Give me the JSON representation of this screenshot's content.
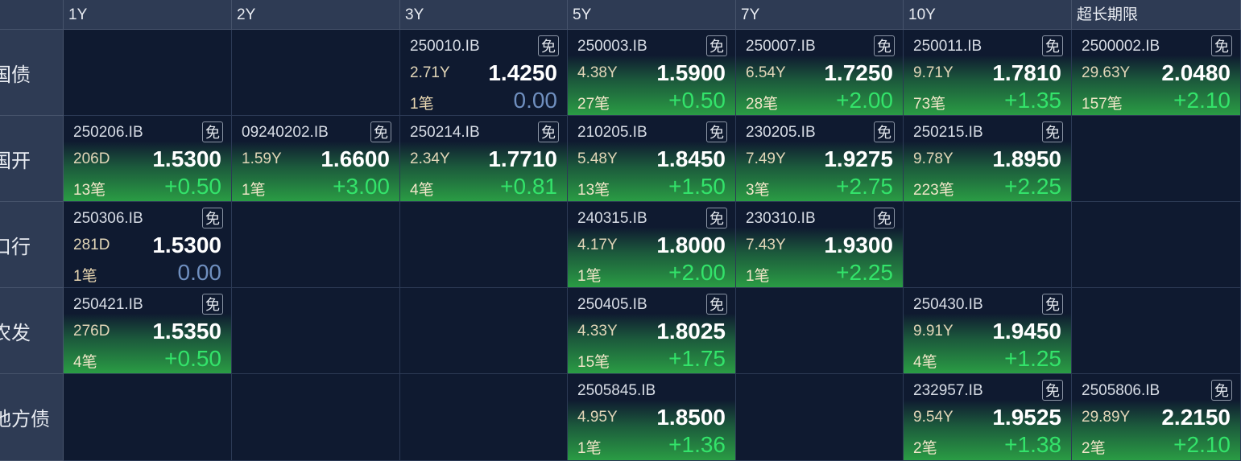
{
  "columns": [
    "1Y",
    "2Y",
    "3Y",
    "5Y",
    "7Y",
    "10Y",
    "超长期限"
  ],
  "rows": [
    {
      "label": "国债",
      "cells": [
        null,
        null,
        {
          "code": "250010.IB",
          "tax": "免",
          "term": "2.71Y",
          "yield": "1.4250",
          "count": "1笔",
          "change": "0.00",
          "style": "neutral"
        },
        {
          "code": "250003.IB",
          "tax": "免",
          "term": "4.38Y",
          "yield": "1.5900",
          "count": "27笔",
          "change": "+0.50",
          "style": "green"
        },
        {
          "code": "250007.IB",
          "tax": "免",
          "term": "6.54Y",
          "yield": "1.7250",
          "count": "28笔",
          "change": "+2.00",
          "style": "green"
        },
        {
          "code": "250011.IB",
          "tax": "免",
          "term": "9.71Y",
          "yield": "1.7810",
          "count": "73笔",
          "change": "+1.35",
          "style": "green"
        },
        {
          "code": "2500002.IB",
          "tax": "免",
          "term": "29.63Y",
          "yield": "2.0480",
          "count": "157笔",
          "change": "+2.10",
          "style": "green"
        }
      ]
    },
    {
      "label": "国开",
      "cells": [
        {
          "code": "250206.IB",
          "tax": "免",
          "term": "206D",
          "yield": "1.5300",
          "count": "13笔",
          "change": "+0.50",
          "style": "green"
        },
        {
          "code": "09240202.IB",
          "tax": "免",
          "term": "1.59Y",
          "yield": "1.6600",
          "count": "1笔",
          "change": "+3.00",
          "style": "green"
        },
        {
          "code": "250214.IB",
          "tax": "免",
          "term": "2.34Y",
          "yield": "1.7710",
          "count": "4笔",
          "change": "+0.81",
          "style": "green"
        },
        {
          "code": "210205.IB",
          "tax": "免",
          "term": "5.48Y",
          "yield": "1.8450",
          "count": "13笔",
          "change": "+1.50",
          "style": "green"
        },
        {
          "code": "230205.IB",
          "tax": "免",
          "term": "7.49Y",
          "yield": "1.9275",
          "count": "3笔",
          "change": "+2.75",
          "style": "green"
        },
        {
          "code": "250215.IB",
          "tax": "免",
          "term": "9.78Y",
          "yield": "1.8950",
          "count": "223笔",
          "change": "+2.25",
          "style": "green"
        },
        null
      ]
    },
    {
      "label": "口行",
      "cells": [
        {
          "code": "250306.IB",
          "tax": "免",
          "term": "281D",
          "yield": "1.5300",
          "count": "1笔",
          "change": "0.00",
          "style": "neutral"
        },
        null,
        null,
        {
          "code": "240315.IB",
          "tax": "免",
          "term": "4.17Y",
          "yield": "1.8000",
          "count": "1笔",
          "change": "+2.00",
          "style": "green"
        },
        {
          "code": "230310.IB",
          "tax": "免",
          "term": "7.43Y",
          "yield": "1.9300",
          "count": "1笔",
          "change": "+2.25",
          "style": "green"
        },
        null,
        null
      ]
    },
    {
      "label": "农发",
      "cells": [
        {
          "code": "250421.IB",
          "tax": "免",
          "term": "276D",
          "yield": "1.5350",
          "count": "4笔",
          "change": "+0.50",
          "style": "green"
        },
        null,
        null,
        {
          "code": "250405.IB",
          "tax": "免",
          "term": "4.33Y",
          "yield": "1.8025",
          "count": "15笔",
          "change": "+1.75",
          "style": "green"
        },
        null,
        {
          "code": "250430.IB",
          "tax": "免",
          "term": "9.91Y",
          "yield": "1.9450",
          "count": "4笔",
          "change": "+1.25",
          "style": "green"
        },
        null
      ]
    },
    {
      "label": "地方债",
      "cells": [
        null,
        null,
        null,
        {
          "code": "2505845.IB",
          "tax": "",
          "term": "4.95Y",
          "yield": "1.8500",
          "count": "1笔",
          "change": "+1.36",
          "style": "green"
        },
        null,
        {
          "code": "232957.IB",
          "tax": "免",
          "term": "9.54Y",
          "yield": "1.9525",
          "count": "2笔",
          "change": "+1.38",
          "style": "green"
        },
        {
          "code": "2505806.IB",
          "tax": "免",
          "term": "29.89Y",
          "yield": "2.2150",
          "count": "2笔",
          "change": "+2.10",
          "style": "green"
        }
      ]
    }
  ]
}
